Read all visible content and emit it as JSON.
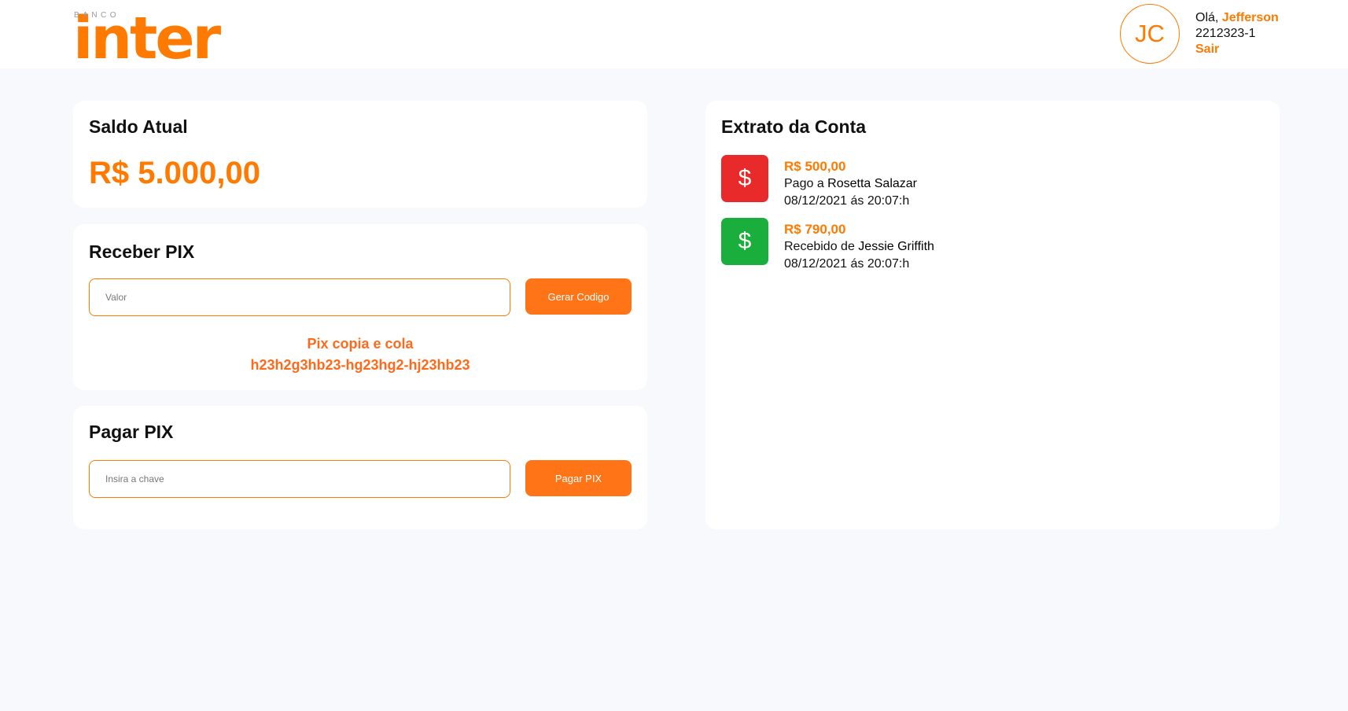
{
  "brand": {
    "small_text": "BANCO",
    "name": "inter",
    "accent_color": "#ff7a00"
  },
  "user": {
    "initials": "JC",
    "greeting": "Olá,",
    "name": "Jefferson",
    "account": "2212323-1",
    "logout_label": "Sair"
  },
  "balance": {
    "title": "Saldo Atual",
    "value": "R$ 5.000,00"
  },
  "receive_pix": {
    "title": "Receber PIX",
    "input_placeholder": "Valor",
    "button_label": "Gerar Codigo",
    "code_label": "Pix copia e cola",
    "code_value": "h23h2g3hb23-hg23hg2-hj23hb23"
  },
  "pay_pix": {
    "title": "Pagar PIX",
    "input_placeholder": "Insira a chave",
    "button_label": "Pagar PIX"
  },
  "statement": {
    "title": "Extrato da Conta",
    "transactions": [
      {
        "type": "debit",
        "icon": "dollar-icon",
        "amount": "R$ 500,00",
        "description_prefix": "Pago a",
        "party": "Rosetta Salazar",
        "datetime": "08/12/2021 ás 20:07:h",
        "color": "#e82a2a"
      },
      {
        "type": "credit",
        "icon": "dollar-icon",
        "amount": "R$ 790,00",
        "description_prefix": "Recebido de",
        "party": "Jessie Griffith",
        "datetime": "08/12/2021 ás 20:07:h",
        "color": "#1aae3c"
      }
    ]
  }
}
